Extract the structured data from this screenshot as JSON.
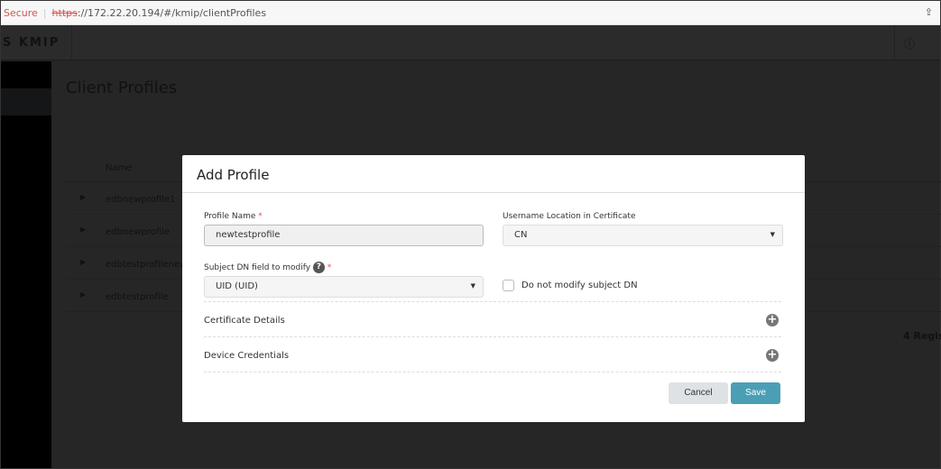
{
  "browser": {
    "secure": "Secure",
    "scheme": "https",
    "url_rest": "://172.22.20.194/#/kmip/clientProfiles",
    "share_icon": "share-icon"
  },
  "header": {
    "brand": "S KMIP",
    "info_icon": "info-icon"
  },
  "page": {
    "title": "Client Profiles",
    "column_name": "Name",
    "rows": [
      "edbnewprofile1",
      "edbnewprofile",
      "edbtestprofilenew",
      "edbtestprofile"
    ],
    "count": "4 Regis"
  },
  "modal": {
    "title": "Add Profile",
    "profile_name_label": "Profile Name",
    "required": "*",
    "profile_name_value": "newtestprofile",
    "username_location_label": "Username Location in Certificate",
    "username_location_value": "CN",
    "subject_dn_label": "Subject DN field to modify",
    "subject_dn_value": "UID (UID)",
    "help": "?",
    "no_modify_label": "Do not modify subject DN",
    "no_modify_checked": false,
    "certificate_details": "Certificate Details",
    "device_credentials": "Device Credentials",
    "plus": "+",
    "cancel": "Cancel",
    "save": "Save"
  },
  "colors": {
    "accent": "#4a9fb5",
    "required": "#d9534f"
  }
}
